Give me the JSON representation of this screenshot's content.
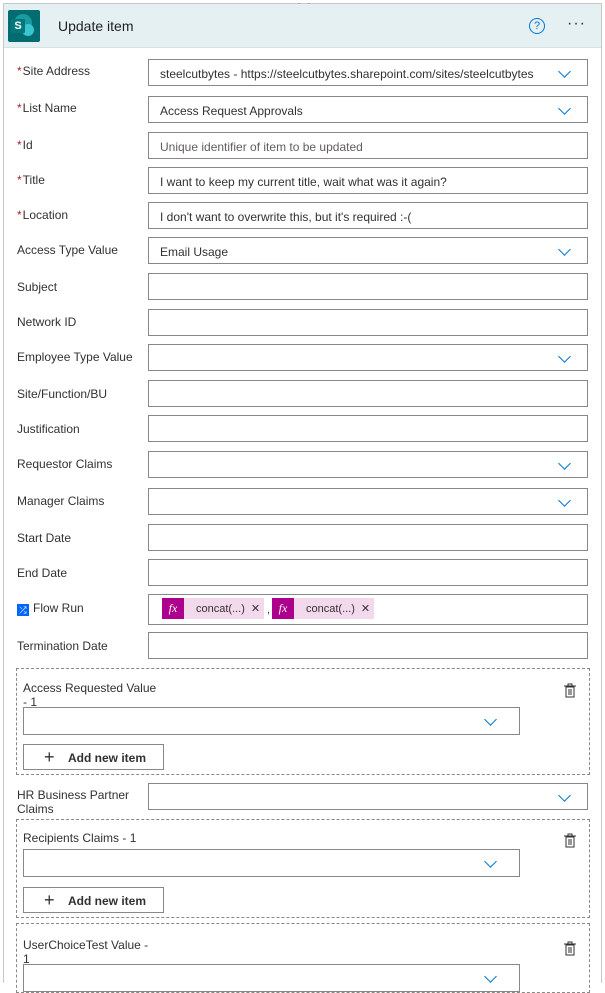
{
  "header": {
    "title": "Update item",
    "help_icon": "help-circle-icon",
    "more_icon": "ellipsis-icon",
    "connector_icon": "sharepoint-icon"
  },
  "fields": {
    "site_address": {
      "label": "Site Address",
      "value": "steelcutbytes - https://steelcutbytes.sharepoint.com/sites/steelcutbytes",
      "required": true
    },
    "list_name": {
      "label": "List Name",
      "value": "Access Request Approvals",
      "required": true
    },
    "id": {
      "label": "Id",
      "placeholder": "Unique identifier of item to be updated",
      "required": true
    },
    "title": {
      "label": "Title",
      "value": "I want to keep my current title, wait what was it again?",
      "required": true
    },
    "location": {
      "label": "Location",
      "value": "I don't want to overwrite this, but it's required :-(",
      "required": true
    },
    "access_type": {
      "label": "Access Type Value",
      "value": "Email Usage"
    },
    "subject": {
      "label": "Subject",
      "value": ""
    },
    "network_id": {
      "label": "Network ID",
      "value": ""
    },
    "employee_type": {
      "label": "Employee Type Value",
      "value": ""
    },
    "site_function": {
      "label": "Site/Function/BU",
      "value": ""
    },
    "justification": {
      "label": "Justification",
      "value": ""
    },
    "requestor_claims": {
      "label": "Requestor Claims",
      "value": ""
    },
    "manager_claims": {
      "label": "Manager Claims",
      "value": ""
    },
    "start_date": {
      "label": "Start Date",
      "value": ""
    },
    "end_date": {
      "label": "End Date",
      "value": ""
    },
    "flow_run": {
      "label": "Flow Run",
      "tokens": [
        {
          "label": "concat(...)",
          "icon": "fx-icon"
        },
        {
          "label": "concat(...)",
          "icon": "fx-icon"
        }
      ]
    },
    "termination_date": {
      "label": "Termination Date",
      "value": ""
    },
    "hr_partner": {
      "label": "HR Business Partner Claims",
      "value": ""
    }
  },
  "groups": {
    "access_requested": {
      "label": "Access Requested Value - 1",
      "add_label": "Add new item"
    },
    "recipients": {
      "label": "Recipients Claims - 1",
      "add_label": "Add new item"
    },
    "user_choice": {
      "label": "UserChoiceTest Value - 1"
    }
  },
  "colors": {
    "header_bg": "#e4f0f2",
    "accent": "#0078d4",
    "required": "#a4262c",
    "token_bg": "#f3d9ec",
    "fx_bg": "#ad008c"
  }
}
